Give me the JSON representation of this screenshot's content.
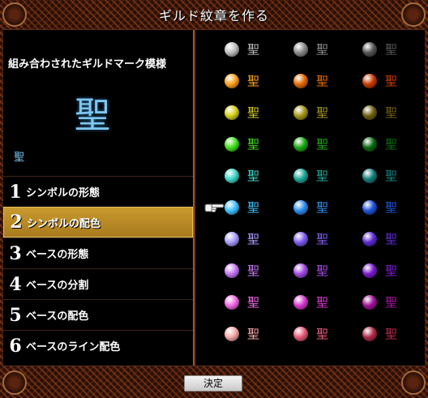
{
  "window": {
    "title": "ギルド紋章を作る"
  },
  "preview": {
    "label": "組み合わされたギルドマーク模様",
    "symbol": "聖",
    "small_symbol": "聖"
  },
  "menu": [
    {
      "num": "1",
      "label": "シンボルの形態"
    },
    {
      "num": "2",
      "label": "シンボルの配色",
      "selected": true
    },
    {
      "num": "3",
      "label": "ベースの形態"
    },
    {
      "num": "4",
      "label": "ベースの分割"
    },
    {
      "num": "5",
      "label": "ベースの配色"
    },
    {
      "num": "6",
      "label": "ベースのライン配色"
    }
  ],
  "symbol_glyph": "聖",
  "palette": [
    {
      "row": "gray",
      "colors": [
        "#bdbdbd",
        "#8a8a8a",
        "#555555"
      ]
    },
    {
      "row": "orange",
      "colors": [
        "#ffa21a",
        "#e66a00",
        "#c83a00"
      ]
    },
    {
      "row": "olive",
      "colors": [
        "#d6d11a",
        "#a6961a",
        "#6f5f12"
      ]
    },
    {
      "row": "green",
      "colors": [
        "#44e01c",
        "#1fa818",
        "#0b6a10"
      ]
    },
    {
      "row": "teal",
      "colors": [
        "#3fd7c8",
        "#1ea89a",
        "#157e7a"
      ]
    },
    {
      "row": "blue",
      "colors": [
        "#3ec2ff",
        "#2e8ef0",
        "#1e52d8"
      ]
    },
    {
      "row": "violet",
      "colors": [
        "#a89cff",
        "#7e5cf0",
        "#5a2ad0"
      ]
    },
    {
      "row": "purple",
      "colors": [
        "#c878f6",
        "#a44ae6",
        "#7a1ad0"
      ]
    },
    {
      "row": "magenta",
      "colors": [
        "#f46ae6",
        "#d83ad0",
        "#a2129a"
      ]
    },
    {
      "row": "pink",
      "colors": [
        "#f8a8a8",
        "#e85a7a",
        "#b02a4a"
      ]
    }
  ],
  "selected": {
    "row": 5,
    "col": 0
  },
  "footer": {
    "confirm_label": "決定"
  },
  "colors": {
    "accent": "#c99a2e",
    "frame": "#2a0f06",
    "preview_symbol": "#7ec8f0"
  }
}
